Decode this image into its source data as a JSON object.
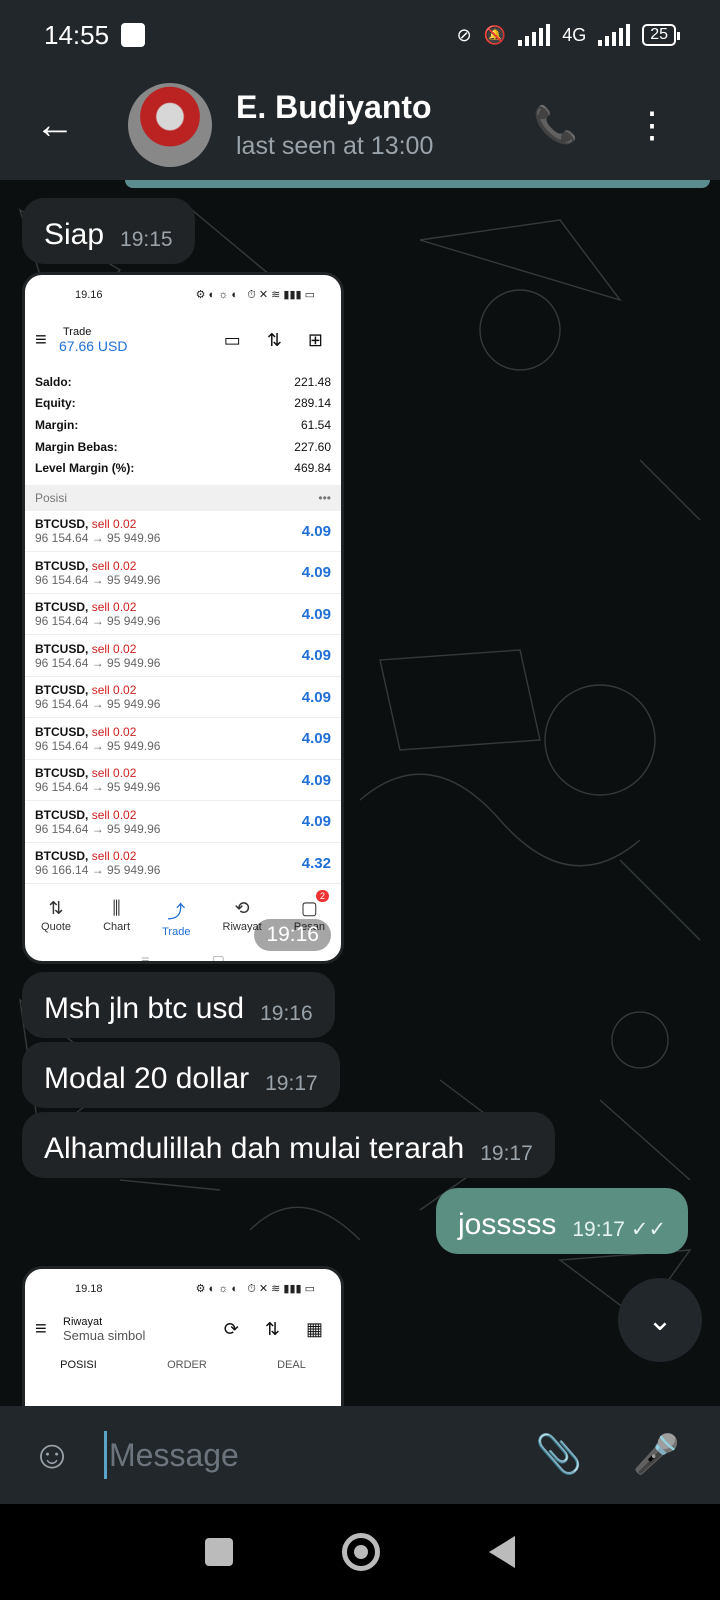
{
  "status": {
    "time": "14:55",
    "net": "4G",
    "battery": "25"
  },
  "header": {
    "name": "E. Budiyanto",
    "last_seen": "last seen at 13:00"
  },
  "messages": [
    {
      "text": "Siap",
      "time": "19:15"
    },
    {
      "text": "Msh jln btc usd",
      "time": "19:16"
    },
    {
      "text": "Modal 20 dollar",
      "time": "19:17"
    },
    {
      "text": "Alhamdulillah dah mulai terarah",
      "time": "19:17"
    },
    {
      "text": "josssss",
      "time": "19:17"
    }
  ],
  "shot1": {
    "status_time": "19.16",
    "title": "Trade",
    "balance": "67.66 USD",
    "summary": [
      {
        "label": "Saldo:",
        "value": "221.48"
      },
      {
        "label": "Equity:",
        "value": "289.14"
      },
      {
        "label": "Margin:",
        "value": "61.54"
      },
      {
        "label": "Margin Bebas:",
        "value": "227.60"
      },
      {
        "label": "Level Margin (%):",
        "value": "469.84"
      }
    ],
    "section": "Posisi",
    "section_more": "•••",
    "positions": [
      {
        "sym": "BTCUSD,",
        "side": "sell 0.02",
        "range": "96 154.64 → 95 949.96",
        "profit": "4.09"
      },
      {
        "sym": "BTCUSD,",
        "side": "sell 0.02",
        "range": "96 154.64 → 95 949.96",
        "profit": "4.09"
      },
      {
        "sym": "BTCUSD,",
        "side": "sell 0.02",
        "range": "96 154.64 → 95 949.96",
        "profit": "4.09"
      },
      {
        "sym": "BTCUSD,",
        "side": "sell 0.02",
        "range": "96 154.64 → 95 949.96",
        "profit": "4.09"
      },
      {
        "sym": "BTCUSD,",
        "side": "sell 0.02",
        "range": "96 154.64 → 95 949.96",
        "profit": "4.09"
      },
      {
        "sym": "BTCUSD,",
        "side": "sell 0.02",
        "range": "96 154.64 → 95 949.96",
        "profit": "4.09"
      },
      {
        "sym": "BTCUSD,",
        "side": "sell 0.02",
        "range": "96 154.64 → 95 949.96",
        "profit": "4.09"
      },
      {
        "sym": "BTCUSD,",
        "side": "sell 0.02",
        "range": "96 154.64 → 95 949.96",
        "profit": "4.09"
      },
      {
        "sym": "BTCUSD,",
        "side": "sell 0.02",
        "range": "96 166.14 → 95 949.96",
        "profit": "4.32"
      }
    ],
    "nav": [
      "Quote",
      "Chart",
      "Trade",
      "Riwayat",
      "Pesan"
    ],
    "badge": "2",
    "msg_time": "19:16"
  },
  "shot2": {
    "status_time": "19.18",
    "title": "Riwayat",
    "subtitle": "Semua simbol",
    "tabs": [
      "POSISI",
      "ORDER",
      "DEAL"
    ]
  },
  "composer": {
    "placeholder": "Message"
  }
}
